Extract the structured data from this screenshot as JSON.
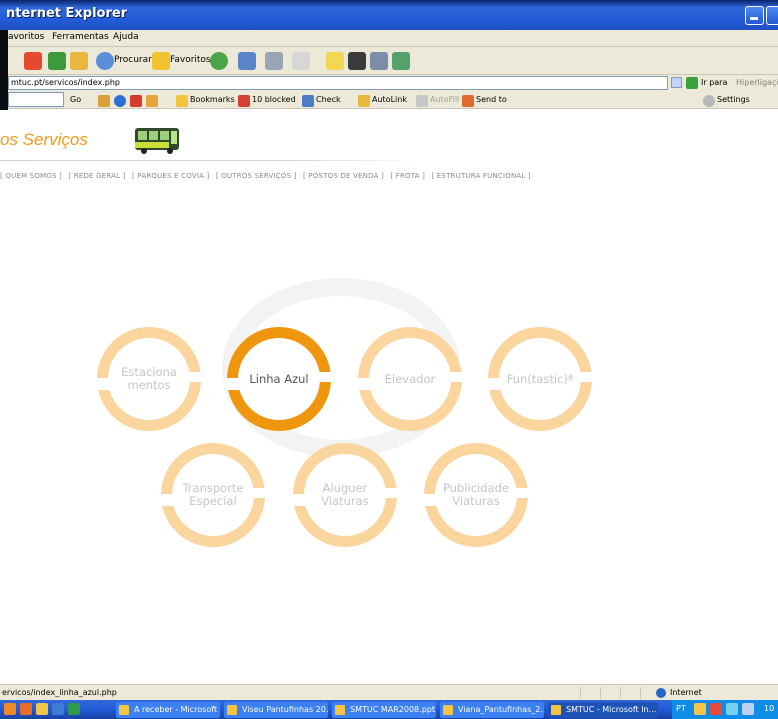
{
  "window": {
    "title": "nternet Explorer"
  },
  "menu": {
    "items": [
      "avoritos",
      "Ferramentas",
      "Ajuda"
    ]
  },
  "toolbar": {
    "search_label": "Procurar",
    "favorites_label": "Favoritos"
  },
  "address": {
    "url": "mtuc.pt/servicos/index.php",
    "go_label": "Ir para",
    "links_label": "Hiperligações"
  },
  "google_toolbar": {
    "go_label": "Go",
    "bookmarks_label": "Bookmarks",
    "blocked_label": "10 blocked",
    "check_label": "Check",
    "autolink_label": "AutoLink",
    "autofill_label": "AutoFill",
    "sendto_label": "Send to",
    "settings_label": "Settings"
  },
  "page": {
    "brand": "os Serviços",
    "nav": [
      "[ QUEM SOMOS ]",
      "[ REDE GERAL ]",
      "[ PARQUES E COVIA ]",
      "[ OUTROS SERVIÇOS ]",
      "[ POSTOS DE VENDA ]",
      "[ FROTA ]",
      "[ ESTRUTURA FUNCIONAL ]"
    ],
    "services": [
      {
        "label": "Estaciona\nmentos",
        "active": false
      },
      {
        "label": "Linha Azul",
        "active": true
      },
      {
        "label": "Elevador",
        "active": false
      },
      {
        "label": "Fun(tastic)ª",
        "active": false
      },
      {
        "label": "Transporte\nEspecial",
        "active": false
      },
      {
        "label": "Aluguer\nViaturas",
        "active": false
      },
      {
        "label": "Publicidade\nViaturas",
        "active": false
      }
    ]
  },
  "statusbar": {
    "text": "ervicos/index_linha_azul.php",
    "zone": "Internet"
  },
  "taskbar": {
    "items": [
      {
        "label": "A receber - Microsoft ...",
        "active": false
      },
      {
        "label": "Viseu Pantufinhas 20...",
        "active": false
      },
      {
        "label": "SMTUC MAR2008.ppt",
        "active": false
      },
      {
        "label": "Viana_Pantufinhas_2...",
        "active": false
      },
      {
        "label": "SMTUC - Microsoft In...",
        "active": true
      }
    ],
    "tray_lang": "PT",
    "tray_time": "10"
  },
  "colors": {
    "accent": "#f29a14",
    "ring_inactive": "#fbd59e",
    "ring_active": "#f0960e"
  }
}
